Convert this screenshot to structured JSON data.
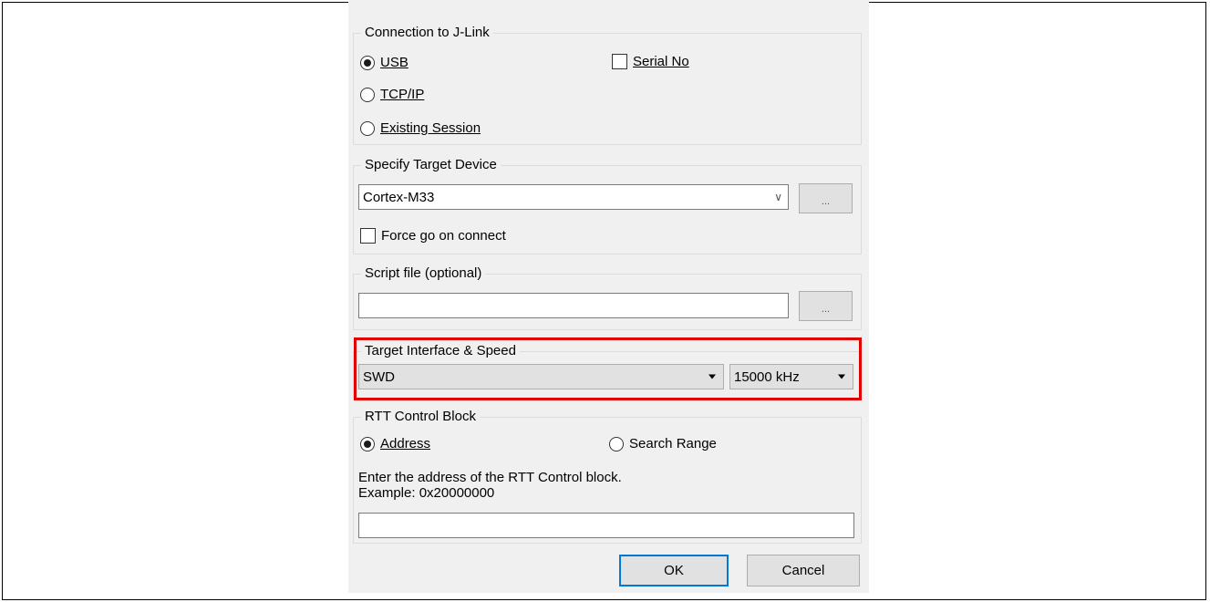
{
  "connection": {
    "title": "Connection to J-Link",
    "usb_label": "USB",
    "tcpip_label": "TCP/IP",
    "existing_label": "Existing Session",
    "serial_label": "Serial No",
    "selected": "USB"
  },
  "target_device": {
    "title": "Specify Target Device",
    "device_value": "Cortex-M33",
    "browse_label": "...",
    "force_go_label": "Force go on connect"
  },
  "script_file": {
    "title": "Script file (optional)",
    "value": "",
    "browse_label": "..."
  },
  "interface": {
    "title": "Target Interface & Speed",
    "interface_value": "SWD",
    "speed_value": "15000 kHz",
    "highlight_color": "#e00000"
  },
  "rtt": {
    "title": "RTT Control Block",
    "address_label": "Address",
    "search_range_label": "Search Range",
    "selected": "Address",
    "hint_line1": "Enter the address of the RTT Control block.",
    "hint_line2": "Example: 0x20000000",
    "address_value": ""
  },
  "buttons": {
    "ok_label": "OK",
    "cancel_label": "Cancel",
    "default_color": "#0078d7"
  }
}
